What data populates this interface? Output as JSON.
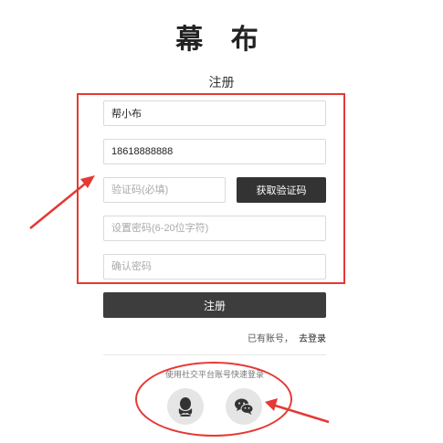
{
  "header": {
    "logo": "幕 布",
    "form_title": "注册"
  },
  "form": {
    "nickname_value": "帮小布",
    "phone_value": "18618888888",
    "code_placeholder": "验证码(必填)",
    "get_code_label": "获取验证码",
    "password_placeholder": "设置密码(6-20位字符)",
    "confirm_placeholder": "确认密码",
    "submit_label": "注册"
  },
  "login": {
    "prompt": "已有账号，",
    "link": "去登录"
  },
  "social": {
    "title": "使用社交平台账号快速登录",
    "providers": [
      {
        "name": "QQ",
        "icon": "qq-penguin-icon"
      },
      {
        "name": "WeChat",
        "icon": "wechat-icon"
      }
    ]
  },
  "annotation_color": "#e53935"
}
